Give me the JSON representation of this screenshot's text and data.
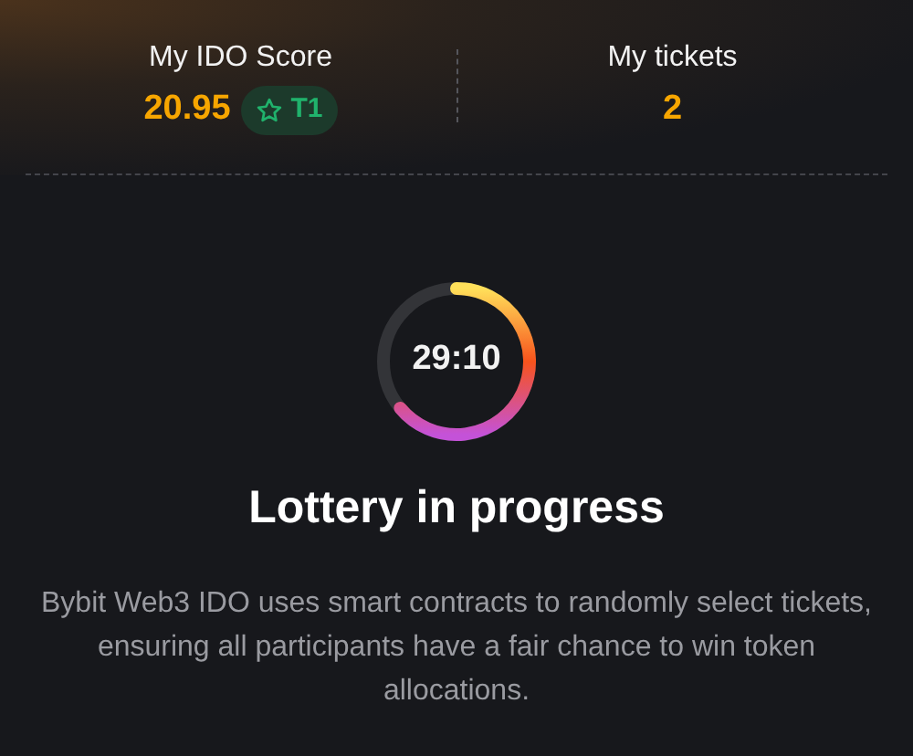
{
  "stats": [
    {
      "label": "My IDO Score",
      "value": "20.95",
      "badge": "T1"
    },
    {
      "label": "My tickets",
      "value": "2"
    }
  ],
  "timer": {
    "time": "29:10"
  },
  "title": "Lottery in progress",
  "description": "Bybit Web3 IDO uses smart contracts to randomly select tickets, ensuring all participants have a fair chance to win token allocations."
}
